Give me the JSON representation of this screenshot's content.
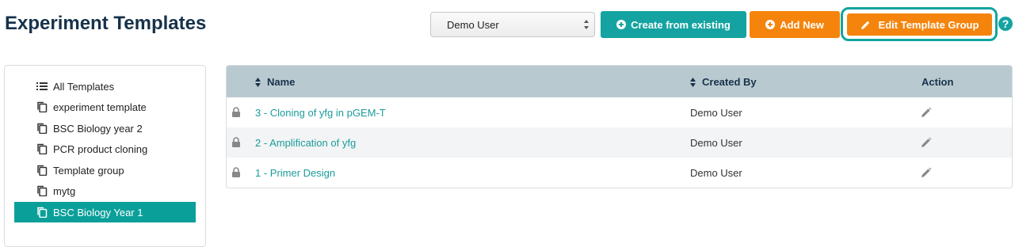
{
  "page": {
    "title": "Experiment Templates"
  },
  "toolbar": {
    "user_select": "Demo User",
    "create_from_existing": "Create from existing",
    "add_new": "Add New",
    "edit_template_group": "Edit Template Group",
    "help": "?"
  },
  "sidebar": {
    "items": [
      {
        "label": "All Templates",
        "icon": "list-icon",
        "active": false
      },
      {
        "label": "experiment template",
        "icon": "copy-icon",
        "active": false
      },
      {
        "label": "BSC Biology year 2",
        "icon": "copy-icon",
        "active": false
      },
      {
        "label": "PCR product cloning",
        "icon": "copy-icon",
        "active": false
      },
      {
        "label": "Template group",
        "icon": "copy-icon",
        "active": false
      },
      {
        "label": "mytg",
        "icon": "copy-icon",
        "active": false
      },
      {
        "label": "BSC Biology Year 1",
        "icon": "copy-icon",
        "active": true
      }
    ]
  },
  "table": {
    "columns": {
      "name": "Name",
      "created_by": "Created By",
      "action": "Action"
    },
    "rows": [
      {
        "name": "3 - Cloning of yfg in pGEM-T",
        "created_by": "Demo User"
      },
      {
        "name": "2 - Amplification of yfg",
        "created_by": "Demo User"
      },
      {
        "name": "1 - Primer Design",
        "created_by": "Demo User"
      }
    ]
  },
  "colors": {
    "teal": "#14a3a1",
    "orange": "#f5840c",
    "header_bg": "#b9c9d0",
    "title": "#16324a"
  }
}
